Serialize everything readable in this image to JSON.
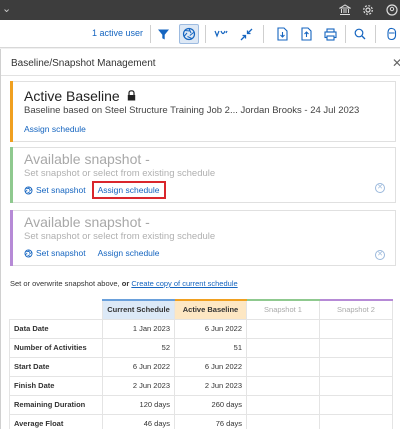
{
  "toolbar": {
    "active_user": "1 active user",
    "icons": [
      "chevron-down-icon",
      "bank-icon",
      "gear-icon",
      "user-circle-icon",
      "filter-icon",
      "aperture-icon",
      "progress-icon",
      "collapse-icon",
      "export-icon",
      "import-icon",
      "print-icon",
      "search-icon",
      "help-icon"
    ]
  },
  "panel": {
    "title": "Baseline/Snapshot Management",
    "active_baseline": {
      "title": "Active Baseline",
      "description": "Baseline based on Steel Structure Training Job 2... Jordan Brooks - 24 Jul 2023",
      "assign_label": "Assign schedule"
    },
    "snapshot1": {
      "title": "Available snapshot -",
      "subtitle": "Set snapshot or select from existing schedule",
      "set_label": "Set snapshot",
      "assign_label": "Assign schedule"
    },
    "snapshot2": {
      "title": "Available snapshot -",
      "subtitle": "Set snapshot or select from existing schedule",
      "set_label": "Set snapshot",
      "assign_label": "Assign schedule"
    },
    "note": {
      "prefix": "Set or overwrite snapshot above,",
      "or": "or",
      "link": "Create copy of current schedule"
    }
  },
  "table": {
    "headers": [
      "Current Schedule",
      "Active Baseline",
      "Snapshot 1",
      "Snapshot 2"
    ],
    "rows": [
      {
        "label": "Data Date",
        "values": [
          "1 Jan 2023",
          "6 Jun 2022",
          "",
          ""
        ]
      },
      {
        "label": "Number of Activities",
        "values": [
          "52",
          "51",
          "",
          ""
        ]
      },
      {
        "label": "Start Date",
        "values": [
          "6 Jun 2022",
          "6 Jun 2022",
          "",
          ""
        ]
      },
      {
        "label": "Finish Date",
        "values": [
          "2 Jun 2023",
          "2 Jun 2023",
          "",
          ""
        ]
      },
      {
        "label": "Remaining Duration",
        "values": [
          "120 days",
          "260 days",
          "",
          ""
        ]
      },
      {
        "label": "Average Float",
        "values": [
          "46 days",
          "76 days",
          "",
          ""
        ]
      }
    ]
  },
  "colors": {
    "accent_blue": "#1565c0",
    "baseline_orange": "#f0a020",
    "snapshot1_green": "#8fc98f",
    "snapshot2_purple": "#b68ad6",
    "highlight_red": "#d9262c"
  }
}
